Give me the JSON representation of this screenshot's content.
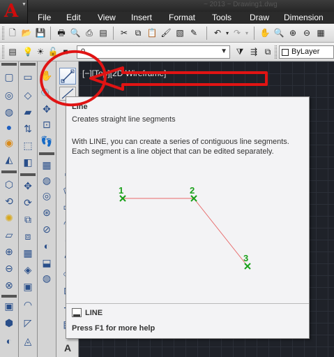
{
  "app": {
    "faint_title": "~ 2013 ~ Drawing1.dwg",
    "logo_letter": "A"
  },
  "menu": [
    "File",
    "Edit",
    "View",
    "Insert",
    "Format",
    "Tools",
    "Draw",
    "Dimension"
  ],
  "toolbar": {
    "layer_value": "0",
    "color_value": "ByLayer"
  },
  "viewport": {
    "label": "[−][Top][2D Wireframe]"
  },
  "tooltip": {
    "title": "Line",
    "description": "Creates straight line segments",
    "detail_lines": [
      "With LINE, you can create a series of contiguous line segments.",
      "Each segment is a line object that can be edited separately."
    ],
    "diagram_points": [
      {
        "label": "1"
      },
      {
        "label": "2"
      },
      {
        "label": "3"
      }
    ],
    "command": "LINE",
    "help": "Press F1 for more help"
  },
  "colors": {
    "annotation": "#e01414",
    "point_marker": "#1aa01a",
    "segment": "#e86a6a",
    "canvas": "#1f2229"
  },
  "icons": {
    "line_tool": "line-tool-icon",
    "pan": "pan-hand-icon"
  }
}
